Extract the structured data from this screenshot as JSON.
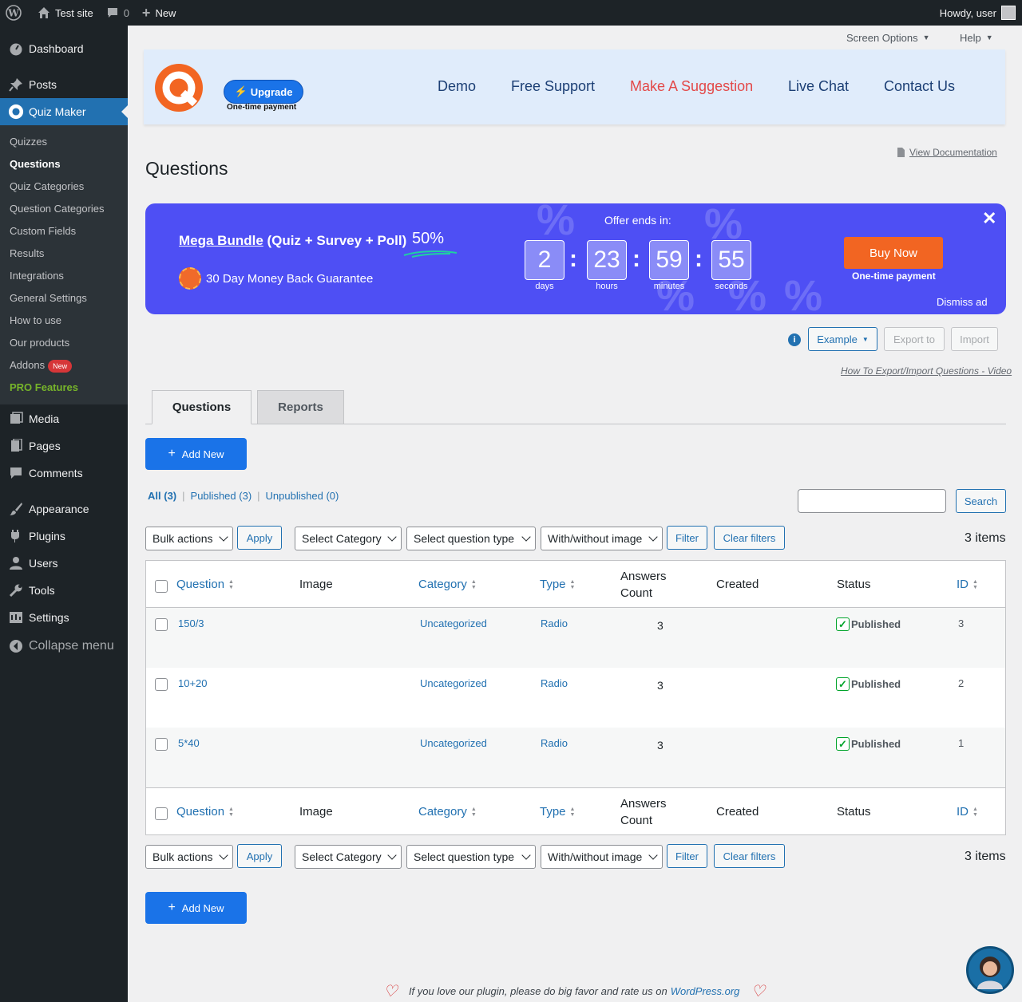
{
  "adminbar": {
    "site_name": "Test site",
    "comments_count": "0",
    "new_label": "New",
    "howdy": "Howdy, user"
  },
  "sidebar": {
    "top_items": [
      {
        "label": "Dashboard",
        "icon": "dashboard-icon"
      },
      {
        "label": "Posts",
        "icon": "pin-icon"
      }
    ],
    "current": {
      "label": "Quiz Maker",
      "icon": "quiz-maker-icon"
    },
    "submenu": [
      "Quizzes",
      "Questions",
      "Quiz Categories",
      "Question Categories",
      "Custom Fields",
      "Results",
      "Integrations",
      "General Settings",
      "How to use",
      "Our products",
      "Addons",
      "PRO Features"
    ],
    "addons_badge": "New",
    "bottom_items": [
      {
        "label": "Media"
      },
      {
        "label": "Pages"
      },
      {
        "label": "Comments"
      },
      {
        "label": "Appearance"
      },
      {
        "label": "Plugins"
      },
      {
        "label": "Users"
      },
      {
        "label": "Tools"
      },
      {
        "label": "Settings"
      },
      {
        "label": "Collapse menu"
      }
    ]
  },
  "screen_options": "Screen Options",
  "help": "Help",
  "header": {
    "upgrade": "Upgrade",
    "upgrade_sub": "One-time payment",
    "nav": [
      "Demo",
      "Free Support",
      "Make A Suggestion",
      "Live Chat",
      "Contact Us"
    ]
  },
  "doc_link": "View Documentation",
  "page_title": "Questions",
  "banner": {
    "title_link": "Mega Bundle",
    "title_rest": " (Quiz + Survey + Poll)",
    "discount": "50%",
    "guarantee": "30 Day Money Back Guarantee",
    "offer_ends": "Offer ends in:",
    "countdown": [
      {
        "value": "2",
        "label": "days"
      },
      {
        "value": "23",
        "label": "hours"
      },
      {
        "value": "59",
        "label": "minutes"
      },
      {
        "value": "55",
        "label": "seconds"
      }
    ],
    "buy_now": "Buy Now",
    "buy_sub": "One-time payment",
    "dismiss": "Dismiss ad"
  },
  "actions": {
    "example": "Example",
    "export": "Export to",
    "import": "Import",
    "video_link": "How To Export/Import Questions - Video"
  },
  "tabs": [
    "Questions",
    "Reports"
  ],
  "add_new": "Add New",
  "views": {
    "all": "All",
    "all_count": "(3)",
    "published": "Published",
    "published_count": "(3)",
    "unpublished": "Unpublished",
    "unpublished_count": "(0)"
  },
  "search_button": "Search",
  "toolbar": {
    "bulk": "Bulk actions",
    "apply": "Apply",
    "category": "Select Category",
    "qtype": "Select question type",
    "image": "With/without image",
    "filter": "Filter",
    "clear": "Clear filters",
    "items": "3 items"
  },
  "table": {
    "columns": {
      "question": "Question",
      "image": "Image",
      "category": "Category",
      "type": "Type",
      "answers_1": "Answers",
      "answers_2": "Count",
      "created": "Created",
      "status": "Status",
      "id": "ID"
    },
    "rows": [
      {
        "question": "150/3",
        "category": "Uncategorized",
        "type": "Radio",
        "answers": "3",
        "status": "Published",
        "id": "3"
      },
      {
        "question": "10+20",
        "category": "Uncategorized",
        "type": "Radio",
        "answers": "3",
        "status": "Published",
        "id": "2"
      },
      {
        "question": "5*40",
        "category": "Uncategorized",
        "type": "Radio",
        "answers": "3",
        "status": "Published",
        "id": "1"
      }
    ]
  },
  "footer": {
    "text": "If you love our plugin, please do big favor and rate us on ",
    "link": "WordPress.org"
  },
  "colors": {
    "accent": "#2271b1",
    "banner": "#4e4ff4",
    "buy": "#f26522",
    "upgrade": "#1a73e8",
    "sidebar": "#1d2327"
  }
}
